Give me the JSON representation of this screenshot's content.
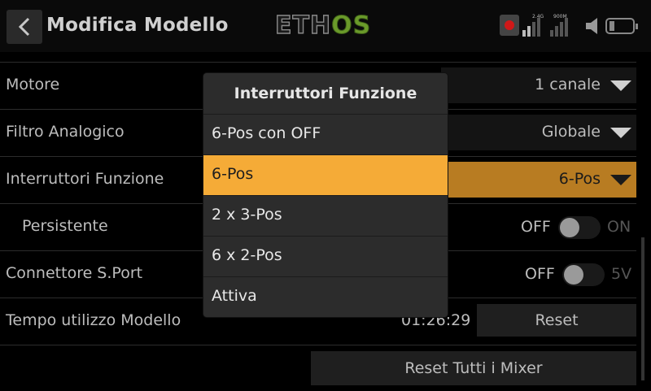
{
  "header": {
    "title": "Modifica Modello",
    "logo_left": "ETH",
    "logo_right": "OS",
    "signal_labels": [
      "2.4G",
      "900M"
    ]
  },
  "settings": {
    "rows": [
      {
        "label": "Motore",
        "value": "1 canale"
      },
      {
        "label": "Filtro Analogico",
        "value": "Globale"
      },
      {
        "label": "Interruttori Funzione",
        "value": "6-Pos"
      },
      {
        "label": "Persistente",
        "off": "OFF",
        "on": "ON"
      },
      {
        "label": "Connettore S.Port",
        "off": "OFF",
        "on": "5V"
      },
      {
        "label": "Tempo utilizzo Modello",
        "time": "01:26:29",
        "button": "Reset"
      }
    ],
    "reset_all": "Reset Tutti i Mixer"
  },
  "modal": {
    "title": "Interruttori Funzione",
    "options": [
      "6-Pos con OFF",
      "6-Pos",
      "2 x 3-Pos",
      "6 x 2-Pos",
      "Attiva"
    ],
    "selected": "6-Pos"
  },
  "colors": {
    "accent": "#f5ab37",
    "active_row": "#b87c22",
    "rec": "#d01818",
    "logo_green": "#6a9a2a"
  }
}
